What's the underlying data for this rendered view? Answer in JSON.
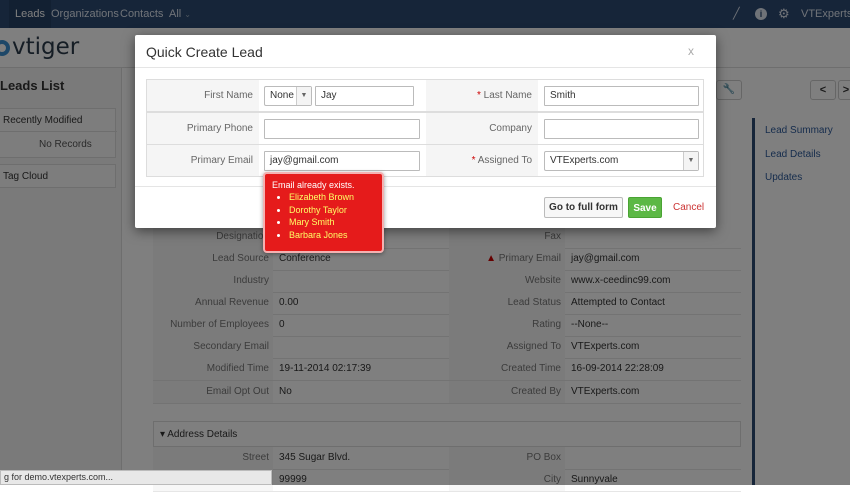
{
  "topnav": {
    "items": [
      "Leads",
      "Organizations",
      "Contacts",
      "All"
    ],
    "user": "VTExperts.co"
  },
  "brand": {
    "logo": "vtiger"
  },
  "left": {
    "title": "Leads List",
    "recent": "Recently Modified",
    "no_records": "No Records",
    "tag_cloud": "Tag Cloud"
  },
  "rightpane": {
    "links": [
      "Lead Summary",
      "Lead Details",
      "Updates"
    ]
  },
  "detail": {
    "rows": [
      {
        "l1": "Designation",
        "v1": "",
        "l2": "Fax",
        "v2": ""
      },
      {
        "l1": "Lead Source",
        "v1": "Conference",
        "l2": "Primary Email",
        "v2": "jay@gmail.com"
      },
      {
        "l1": "Industry",
        "v1": "",
        "l2": "Website",
        "v2": "www.x-ceedinc99.com"
      },
      {
        "l1": "Annual Revenue",
        "v1": "0.00",
        "l2": "Lead Status",
        "v2": "Attempted to Contact"
      },
      {
        "l1": "Number of Employees",
        "v1": "0",
        "l2": "Rating",
        "v2": "--None--"
      },
      {
        "l1": "Secondary Email",
        "v1": "",
        "l2": "Assigned To",
        "v2": "VTExperts.com"
      },
      {
        "l1": "Modified Time",
        "v1": "19-11-2014 02:17:39",
        "l2": "Created Time",
        "v2": "16-09-2014 22:28:09"
      },
      {
        "l1": "Email Opt Out",
        "v1": "No",
        "l2": "Created By",
        "v2": "VTExperts.com"
      }
    ],
    "address_header": "Address Details",
    "address_rows": [
      {
        "l1": "Street",
        "v1": "345 Sugar Blvd.",
        "l2": "PO Box",
        "v2": ""
      },
      {
        "l1": "",
        "v1": "99999",
        "l2": "City",
        "v2": "Sunnyvale"
      }
    ]
  },
  "status_bar": "g for demo.vtexperts.com...",
  "modal": {
    "title": "Quick Create Lead",
    "close": "x",
    "fields": {
      "first_name_label": "First Name",
      "salutation": "None",
      "first_name": "Jay",
      "last_name_label": "Last Name",
      "last_name": "Smith",
      "phone_label": "Primary Phone",
      "phone": "",
      "company_label": "Company",
      "company": "",
      "email_label": "Primary Email",
      "email": "jay@gmail.com",
      "assigned_label": "Assigned To",
      "assigned": "VTExperts.com"
    },
    "buttons": {
      "full_form": "Go to full form",
      "save": "Save",
      "cancel": "Cancel"
    },
    "error": {
      "title": "Email already exists.",
      "matches": [
        "Elizabeth Brown",
        "Dorothy Taylor",
        "Mary Smith",
        "Barbara Jones"
      ]
    }
  }
}
